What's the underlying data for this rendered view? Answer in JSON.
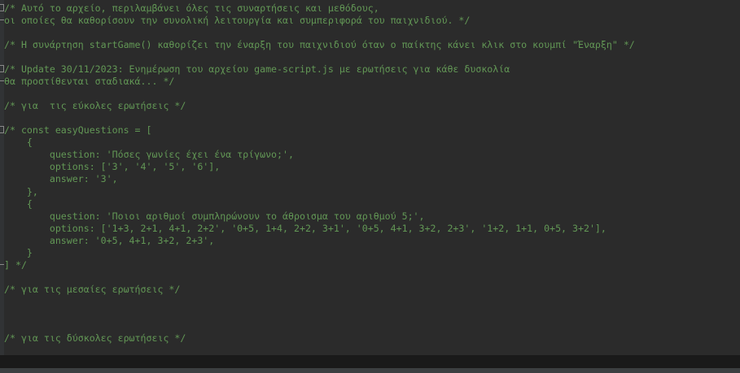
{
  "editor": {
    "lines": [
      "/* Αυτό το αρχείο, περιλαμβάνει όλες τις συναρτήσεις και μεθόδους,",
      "οι οποίες θα καθορίσουν την συνολική λειτουργία και συμπεριφορά του παιχνιδιού. */",
      "",
      "/* Η συνάρτηση startGame() καθορίζει την έναρξη του παιχνιδιού όταν ο παίκτης κάνει κλικ στο κουμπί \"Έναρξη\" */",
      "",
      "/* Update 30/11/2023: Ενημέρωση του αρχείου game-script.js με ερωτήσεις για κάθε δυσκολία",
      "θα προστίθενται σταδιακά... */",
      "",
      "/* για  τις εύκολες ερωτήσεις */",
      "",
      "/* const easyQuestions = [",
      "    {",
      "        question: 'Πόσες γωνίες έχει ένα τρίγωνο;',",
      "        options: ['3', '4', '5', '6'],",
      "        answer: '3',",
      "    },",
      "    {",
      "        question: 'Ποιοι αριθμοί συμπληρώνουν το άθροισμα του αριθμού 5;',",
      "        options: ['1+3, 2+1, 4+1, 2+2', '0+5, 1+4, 2+2, 3+1', '0+5, 4+1, 3+2, 2+3', '1+2, 1+1, 0+5, 3+2'],",
      "        answer: '0+5, 4+1, 3+2, 2+3',",
      "    }",
      "] */",
      "",
      "/* για τις μεσαίες ερωτήσεις */",
      "",
      "",
      "",
      "/* για τις δύσκολες ερωτήσεις */"
    ]
  }
}
